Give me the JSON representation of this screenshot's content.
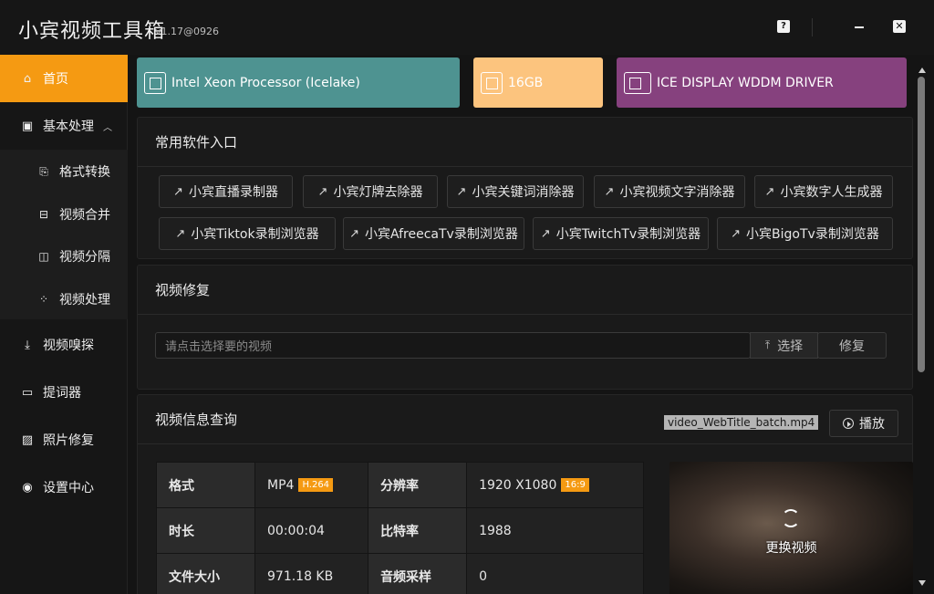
{
  "app": {
    "title": "小宾视频工具箱",
    "version": "v1.17@0926"
  },
  "window_controls": {
    "help_glyph": "?",
    "close_glyph": "✕"
  },
  "sidebar": {
    "items": [
      {
        "label": "首页",
        "icon": "home-icon",
        "active": true
      },
      {
        "label": "基本处理",
        "icon": "processing-icon",
        "expanded": true
      },
      {
        "label": "视频嗅探",
        "icon": "download-icon"
      },
      {
        "label": "提词器",
        "icon": "teleprompter-icon"
      },
      {
        "label": "照片修复",
        "icon": "photo-icon"
      },
      {
        "label": "设置中心",
        "icon": "settings-icon"
      }
    ],
    "sub_items": [
      {
        "label": "格式转换",
        "icon": "file-convert-icon"
      },
      {
        "label": "视频合并",
        "icon": "merge-icon"
      },
      {
        "label": "视频分隔",
        "icon": "split-icon"
      },
      {
        "label": "视频处理",
        "icon": "process-icon"
      }
    ]
  },
  "hardware": {
    "cpu": "Intel Xeon Processor (Icelake)",
    "ram": "16GB",
    "gpu": "ICE DISPLAY WDDM DRIVER",
    "colors": {
      "cpu": "#4e9391",
      "ram": "#fcc47e",
      "gpu": "#86417e"
    }
  },
  "software": {
    "title": "常用软件入口",
    "buttons": [
      "小宾直播录制器",
      "小宾灯牌去除器",
      "小宾关键词消除器",
      "小宾视频文字消除器",
      "小宾数字人生成器",
      "小宾Tiktok录制浏览器",
      "小宾AfreecaTv录制浏览器",
      "小宾TwitchTv录制浏览器",
      "小宾BigoTv录制浏览器"
    ]
  },
  "repair": {
    "title": "视频修复",
    "input_placeholder": "请点击选择要的视频",
    "select_label": "选择",
    "repair_label": "修复"
  },
  "video_info": {
    "title": "视频信息查询",
    "filename": "video_WebTitle_batch.mp4",
    "play_label": "播放",
    "rows": [
      {
        "k1": "格式",
        "v1": "MP4",
        "b1": "H.264",
        "k2": "分辨率",
        "v2": "1920 X1080",
        "b2": "16:9"
      },
      {
        "k1": "时长",
        "v1": "00:00:04",
        "k2": "比特率",
        "v2": "1988"
      },
      {
        "k1": "文件大小",
        "v1": "971.18 KB",
        "k2": "音频采样",
        "v2": "0"
      }
    ],
    "change_label": "更换视频"
  },
  "accent_color": "#f59a12"
}
